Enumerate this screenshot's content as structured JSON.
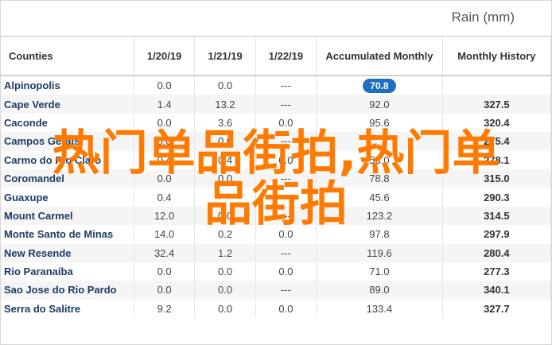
{
  "header": {
    "unit_label": "Rain (mm)"
  },
  "table": {
    "columns": [
      "Counties",
      "1/20/19",
      "1/21/19",
      "1/22/19",
      "Accumulated Monthly",
      "Monthly History"
    ],
    "rows": [
      [
        "Alpinopolis",
        "0.0",
        "0.0",
        "---",
        "70.8",
        ""
      ],
      [
        "Cape Verde",
        "1.4",
        "13.2",
        "---",
        "92.0",
        "327.5"
      ],
      [
        "Caconde",
        "0.0",
        "3.6",
        "0.0",
        "95.6",
        "320.4"
      ],
      [
        "Campos Gerais",
        "0.0",
        "0.0",
        "---",
        "",
        "275.4"
      ],
      [
        "Carmo do Rio Claro",
        "0.4",
        "0.4",
        "0.0",
        "53.0",
        "278.1"
      ],
      [
        "Coromandel",
        "0.0",
        "0.0",
        "---",
        "78.8",
        "315.0"
      ],
      [
        "Guaxupe",
        "0.4",
        "",
        "---",
        "45.6",
        "290.3"
      ],
      [
        "Mount Carmel",
        "12.0",
        "0.0",
        "---",
        "123.2",
        "314.5"
      ],
      [
        "Monte Santo de Minas",
        "14.0",
        "0.2",
        "0.0",
        "97.8",
        "297.9"
      ],
      [
        "New Resende",
        "32.4",
        "1.2",
        "---",
        "119.6",
        "280.4"
      ],
      [
        "Rio Paranaíba",
        "0.0",
        "0.0",
        "0.0",
        "71.0",
        "277.3"
      ],
      [
        "Sao Jose do Rio Pardo",
        "0.0",
        "0.0",
        "---",
        "89.0",
        "340.1"
      ],
      [
        "Serra do Salitre",
        "9.2",
        "0.0",
        "0.0",
        "133.4",
        "327.7"
      ]
    ]
  },
  "watermark": {
    "line1": "热门单品街拍,热门单",
    "line2": "品街拍"
  }
}
